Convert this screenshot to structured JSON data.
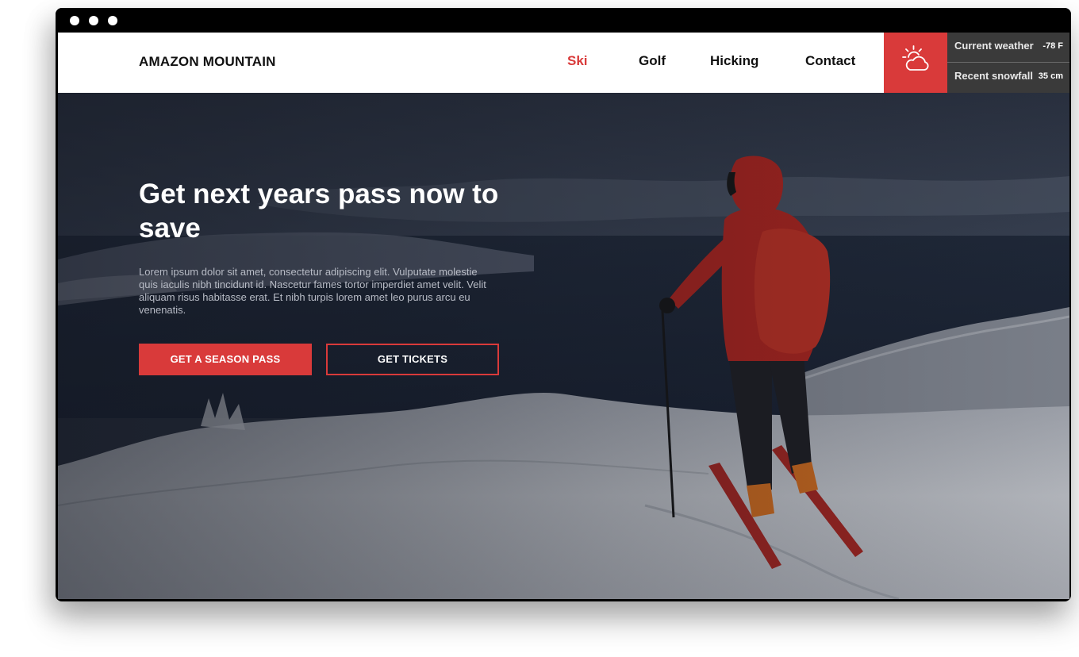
{
  "brand": {
    "name": "AMAZON MOUNTAIN"
  },
  "nav": {
    "items": [
      {
        "label": "Ski",
        "active": true
      },
      {
        "label": "Golf",
        "active": false
      },
      {
        "label": "Hicking",
        "active": false
      },
      {
        "label": "Contact",
        "active": false
      }
    ]
  },
  "weather": {
    "icon": "sun-cloud-icon",
    "current_label": "Current weather",
    "current_value": "-78 F",
    "snowfall_label": "Recent snowfall",
    "snowfall_value": "35 cm"
  },
  "hero": {
    "headline": "Get next years pass now to save",
    "body": "Lorem ipsum dolor sit amet, consectetur adipiscing elit. Vulputate molestie quis iaculis nibh tincidunt id. Nascetur fames tortor imperdiet amet velit. Velit aliquam risus habitasse erat. Et nibh turpis lorem amet leo purus arcu eu venenatis.",
    "primary_button": "GET A SEASON PASS",
    "secondary_button": "GET TICKETS"
  },
  "colors": {
    "accent": "#d93a3a",
    "nav_text": "#111111",
    "panel_dark": "#3a3a3a"
  }
}
